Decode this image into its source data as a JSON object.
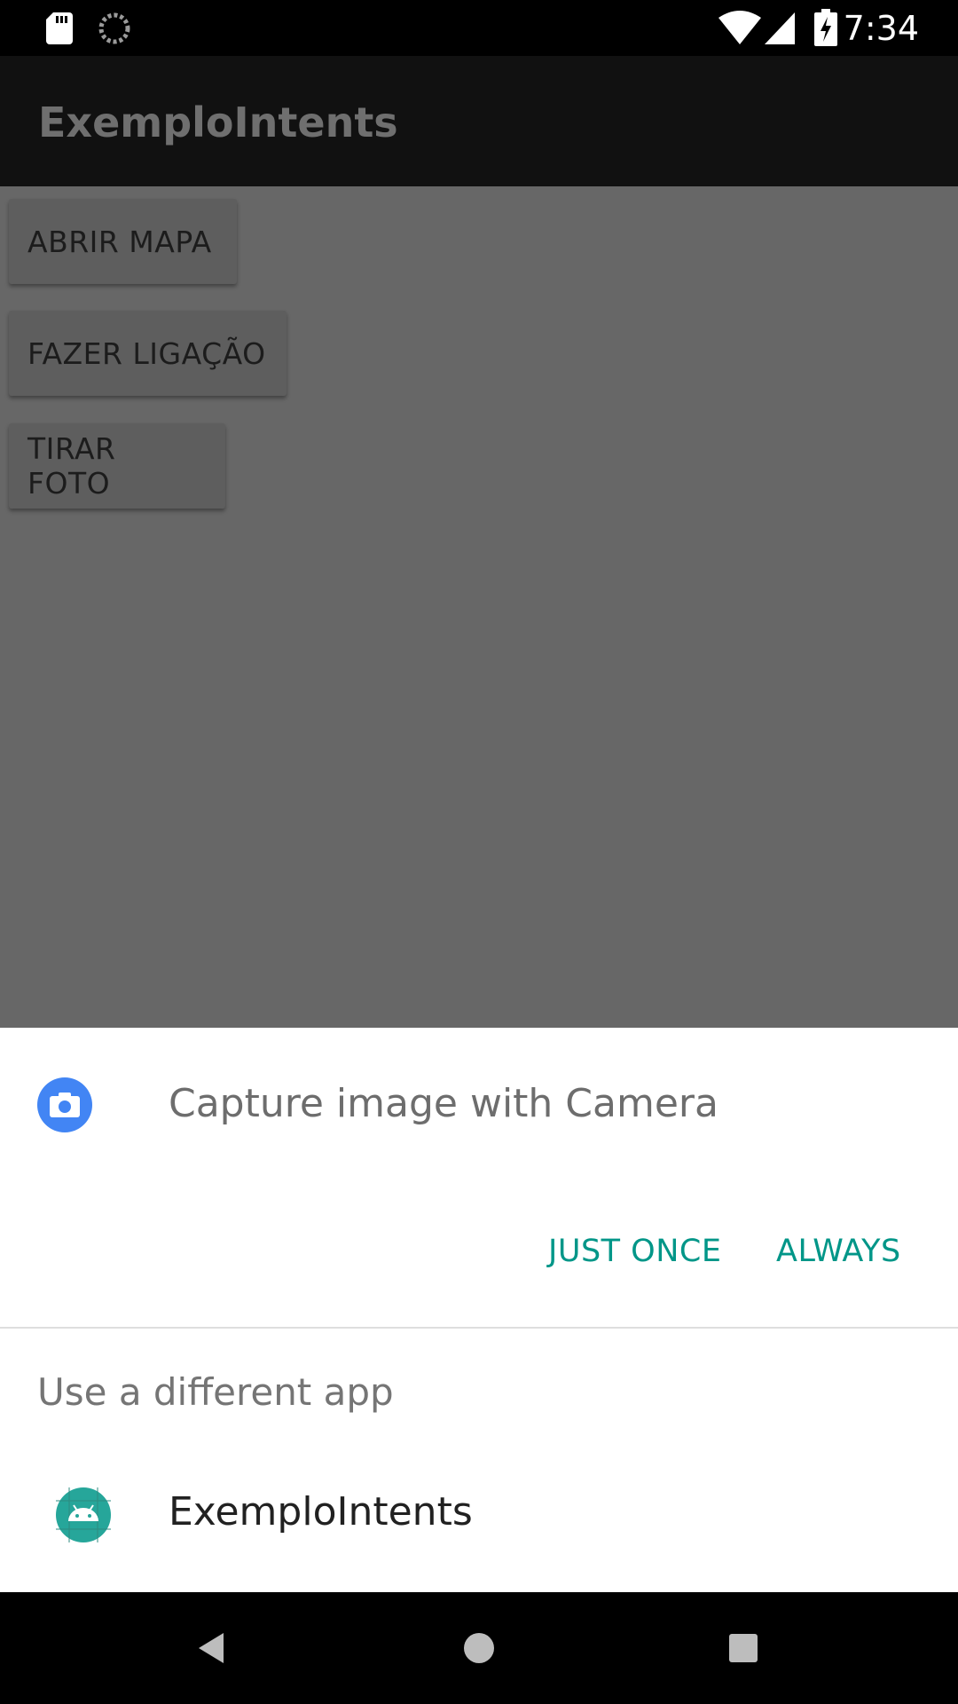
{
  "status_bar": {
    "time": "7:34",
    "icons": [
      "sd-card-icon",
      "sync-icon",
      "wifi-icon",
      "signal-icon",
      "battery-charging-icon"
    ]
  },
  "app": {
    "title": "ExemploIntents",
    "buttons": [
      {
        "label": "ABRIR MAPA"
      },
      {
        "label": "FAZER LIGAÇÃO"
      },
      {
        "label": "TIRAR FOTO"
      }
    ]
  },
  "chooser": {
    "default_app_label": "Capture image with Camera",
    "default_app_icon": "camera-icon",
    "just_once_label": "JUST ONCE",
    "always_label": "ALWAYS",
    "different_app_label": "Use a different app",
    "apps": [
      {
        "name": "ExemploIntents",
        "icon": "android-icon"
      }
    ]
  },
  "nav_bar": {
    "icons": [
      "back-icon",
      "home-icon",
      "recents-icon"
    ]
  },
  "colors": {
    "accent": "#009688",
    "camera_blue": "#4285f4",
    "android_teal": "#26a69a"
  }
}
